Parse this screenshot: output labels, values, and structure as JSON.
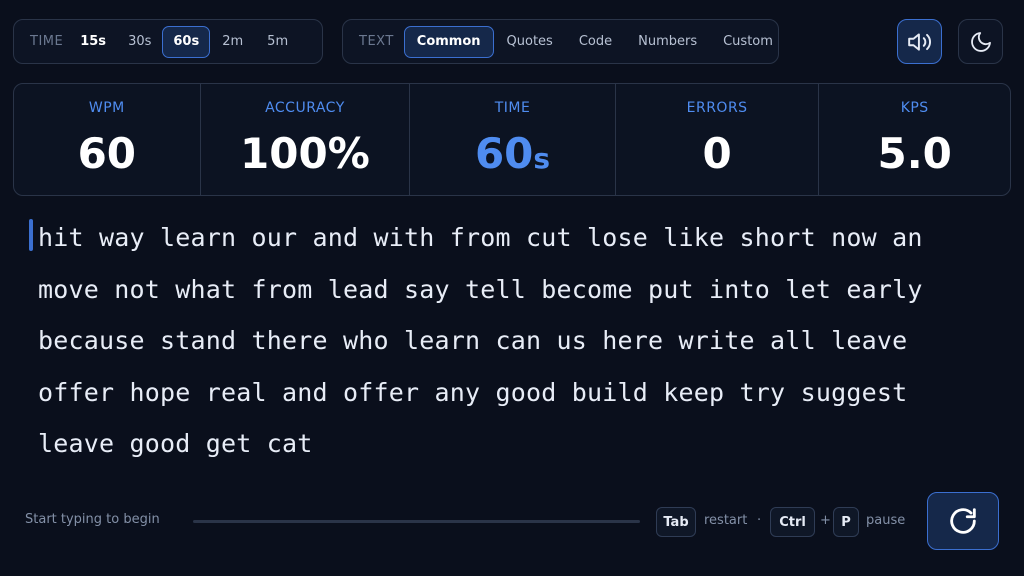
{
  "time_group": {
    "label": "TIME",
    "options": [
      "15s",
      "30s",
      "60s",
      "2m",
      "5m"
    ],
    "selected": "60s"
  },
  "text_group": {
    "label": "TEXT",
    "options": [
      "Common",
      "Quotes",
      "Code",
      "Numbers",
      "Custom"
    ],
    "selected": "Common"
  },
  "icons": {
    "sound": "speaker-icon",
    "theme": "moon-icon",
    "restart": "refresh-icon"
  },
  "stats": {
    "wpm": {
      "label": "WPM",
      "value": "60"
    },
    "accuracy": {
      "label": "ACCURACY",
      "value": "100%"
    },
    "time": {
      "label": "TIME",
      "value": "60",
      "unit": "s"
    },
    "errors": {
      "label": "ERRORS",
      "value": "0"
    },
    "kps": {
      "label": "KPS",
      "value": "5.0"
    }
  },
  "text_lines": [
    "hit way learn our and with from cut lose like short now an",
    "move not what from lead say tell become put into let early",
    "because stand there who learn can us here write all leave",
    "offer hope real and offer any good build keep try suggest",
    "leave good get cat"
  ],
  "footer": {
    "hint": "Start typing to begin",
    "progress": 0,
    "tab_key": "Tab",
    "restart_label": "restart",
    "separator": "·",
    "ctrl_key": "Ctrl",
    "plus": "+",
    "p_key": "P",
    "pause_label": "pause"
  },
  "colors": {
    "accent": "#4f8cf0",
    "background": "#0a0f1c",
    "border": "#2a3448"
  }
}
